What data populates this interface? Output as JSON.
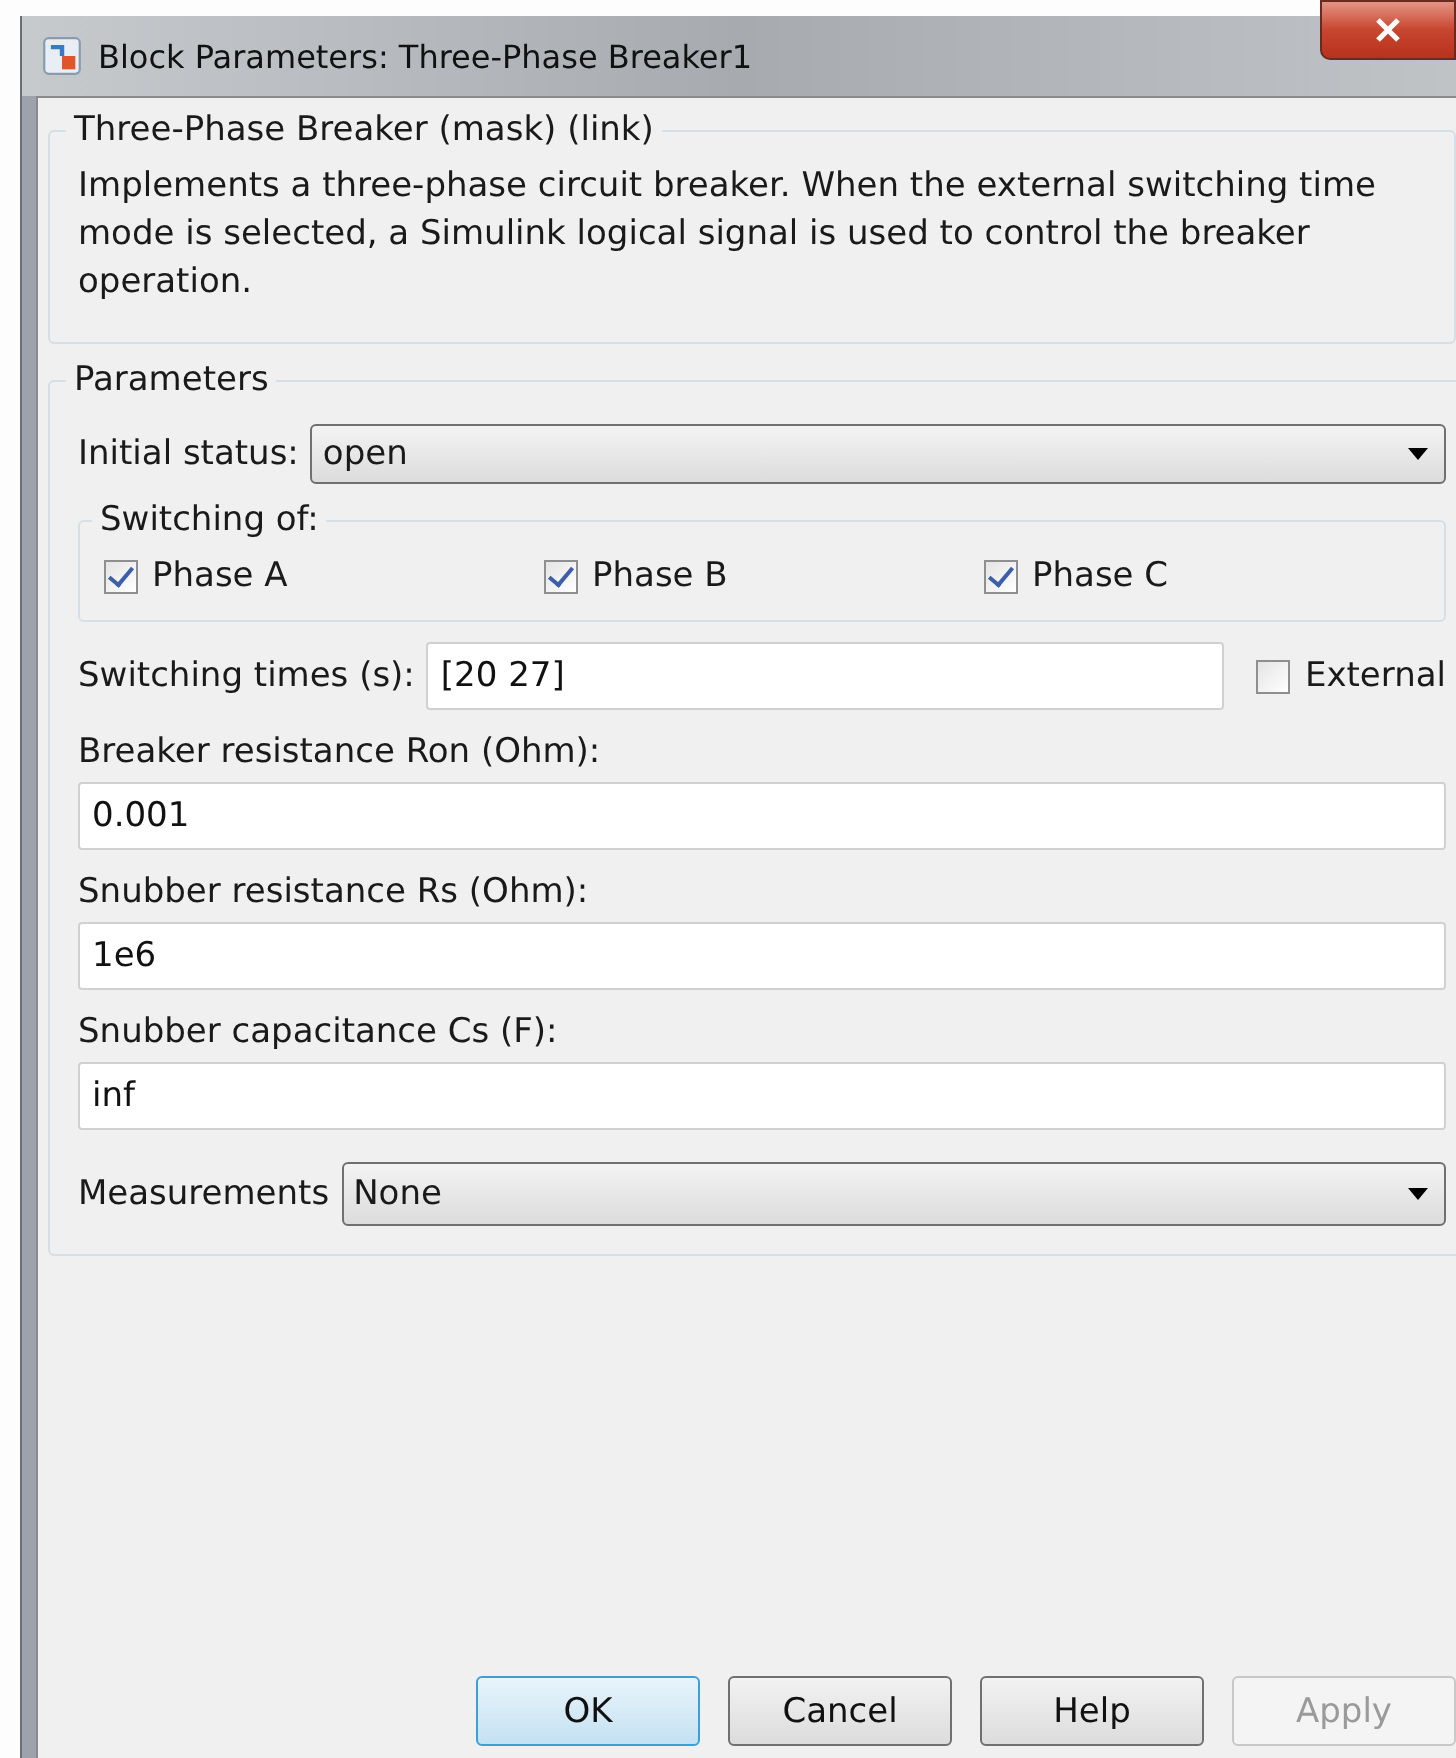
{
  "window": {
    "title": "Block Parameters: Three-Phase Breaker1"
  },
  "description": {
    "title": "Three-Phase Breaker (mask) (link)",
    "text": "Implements a three-phase circuit breaker. When the external switching time mode is selected, a Simulink logical signal is used to control the breaker operation."
  },
  "parameters": {
    "title": "Parameters",
    "initial_status": {
      "label": "Initial status:",
      "value": "open"
    },
    "switching_of": {
      "title": "Switching of:",
      "phases": [
        {
          "label": "Phase A",
          "checked": true
        },
        {
          "label": "Phase B",
          "checked": true
        },
        {
          "label": "Phase C",
          "checked": true
        }
      ]
    },
    "switching_times": {
      "label": "Switching times (s):",
      "value": "[20 27]",
      "external": {
        "label": "External",
        "checked": false
      }
    },
    "fields": [
      {
        "label": "Breaker resistance Ron (Ohm):",
        "value": "0.001"
      },
      {
        "label": "Snubber resistance Rs (Ohm):",
        "value": "1e6"
      },
      {
        "label": "Snubber capacitance Cs (F):",
        "value": "inf"
      }
    ],
    "measurements": {
      "label": "Measurements",
      "value": "None"
    }
  },
  "buttons": [
    {
      "label": "OK",
      "default": true,
      "disabled": false
    },
    {
      "label": "Cancel",
      "default": false,
      "disabled": false
    },
    {
      "label": "Help",
      "default": false,
      "disabled": false
    },
    {
      "label": "Apply",
      "default": false,
      "disabled": true
    }
  ]
}
